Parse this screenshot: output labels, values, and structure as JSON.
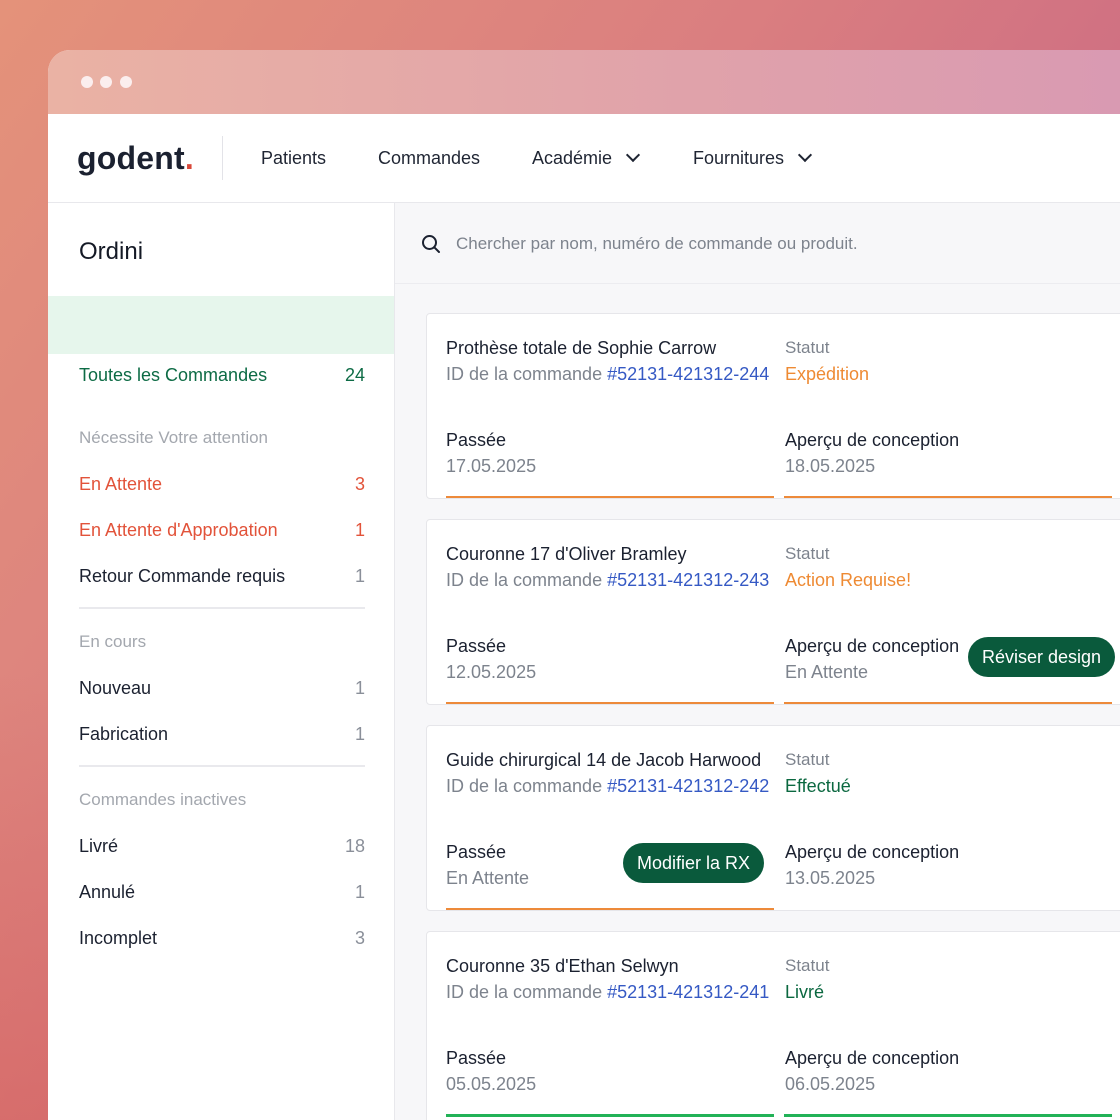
{
  "app": {
    "logo_text": "godent",
    "logo_dot": ".",
    "accent_color": "#0a5a3c"
  },
  "nav": {
    "items": [
      {
        "label": "Patients",
        "has_dropdown": false
      },
      {
        "label": "Commandes",
        "has_dropdown": false
      },
      {
        "label": "Académie",
        "has_dropdown": true
      },
      {
        "label": "Fournitures",
        "has_dropdown": true
      }
    ]
  },
  "sidebar": {
    "title": "Ordini",
    "all": {
      "label": "Toutes les Commandes",
      "count": "24"
    },
    "attention": {
      "heading": "Nécessite Votre attention",
      "items": [
        {
          "label": "En Attente",
          "count": "3"
        },
        {
          "label": "En Attente d'Approbation",
          "count": "1"
        },
        {
          "label": "Retour Commande requis",
          "count": "1"
        }
      ]
    },
    "in_progress": {
      "heading": "En cours",
      "items": [
        {
          "label": "Nouveau",
          "count": "1"
        },
        {
          "label": "Fabrication",
          "count": "1"
        }
      ]
    },
    "inactive": {
      "heading": "Commandes inactives",
      "items": [
        {
          "label": "Livré",
          "count": "18"
        },
        {
          "label": "Annulé",
          "count": "1"
        },
        {
          "label": "Incomplet",
          "count": "3"
        }
      ]
    }
  },
  "search": {
    "placeholder": "Chercher par nom, numéro de commande ou produit."
  },
  "labels": {
    "id_prefix": "ID de la commande",
    "status": "Statut",
    "placed": "Passée",
    "design_preview": "Aperçu de conception"
  },
  "orders": [
    {
      "title": "Prothèse totale de Sophie Carrow",
      "order_id": "#52131-421312-244",
      "status": "Expédition",
      "status_color": "#ee8a33",
      "placed": "17.05.2025",
      "design": "18.05.2025",
      "bar_color": "#ed8a3a"
    },
    {
      "title": "Couronne 17 d'Oliver Bramley",
      "order_id": "#52131-421312-243",
      "status": "Action Requise!",
      "status_color": "#ee8a33",
      "placed": "12.05.2025",
      "design": "En Attente",
      "action": "Réviser design",
      "bar_color": "#ed8a3a"
    },
    {
      "title": "Guide chirurgical 14 de Jacob Harwood",
      "order_id": "#52131-421312-242",
      "status": "Effectué",
      "status_color": "#0b6840",
      "placed": "En Attente",
      "design": "13.05.2025",
      "action": "Modifier la RX",
      "bar_color": "#ed8a3a"
    },
    {
      "title": "Couronne 35 d'Ethan Selwyn",
      "order_id": "#52131-421312-241",
      "status": "Livré",
      "status_color": "#0b6840",
      "placed": "05.05.2025",
      "design": "06.05.2025",
      "bar_color": "#22b257"
    }
  ]
}
